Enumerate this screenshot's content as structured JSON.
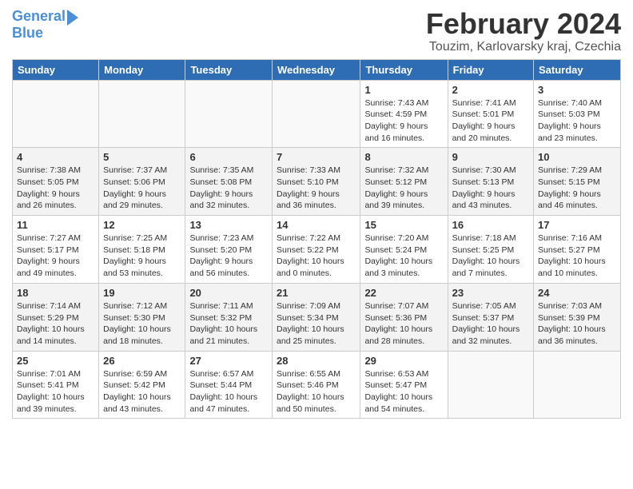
{
  "header": {
    "logo_line1": "General",
    "logo_line2": "Blue",
    "title": "February 2024",
    "subtitle": "Touzim, Karlovarsky kraj, Czechia"
  },
  "columns": [
    "Sunday",
    "Monday",
    "Tuesday",
    "Wednesday",
    "Thursday",
    "Friday",
    "Saturday"
  ],
  "weeks": [
    [
      {
        "num": "",
        "info": ""
      },
      {
        "num": "",
        "info": ""
      },
      {
        "num": "",
        "info": ""
      },
      {
        "num": "",
        "info": ""
      },
      {
        "num": "1",
        "info": "Sunrise: 7:43 AM\nSunset: 4:59 PM\nDaylight: 9 hours\nand 16 minutes."
      },
      {
        "num": "2",
        "info": "Sunrise: 7:41 AM\nSunset: 5:01 PM\nDaylight: 9 hours\nand 20 minutes."
      },
      {
        "num": "3",
        "info": "Sunrise: 7:40 AM\nSunset: 5:03 PM\nDaylight: 9 hours\nand 23 minutes."
      }
    ],
    [
      {
        "num": "4",
        "info": "Sunrise: 7:38 AM\nSunset: 5:05 PM\nDaylight: 9 hours\nand 26 minutes."
      },
      {
        "num": "5",
        "info": "Sunrise: 7:37 AM\nSunset: 5:06 PM\nDaylight: 9 hours\nand 29 minutes."
      },
      {
        "num": "6",
        "info": "Sunrise: 7:35 AM\nSunset: 5:08 PM\nDaylight: 9 hours\nand 32 minutes."
      },
      {
        "num": "7",
        "info": "Sunrise: 7:33 AM\nSunset: 5:10 PM\nDaylight: 9 hours\nand 36 minutes."
      },
      {
        "num": "8",
        "info": "Sunrise: 7:32 AM\nSunset: 5:12 PM\nDaylight: 9 hours\nand 39 minutes."
      },
      {
        "num": "9",
        "info": "Sunrise: 7:30 AM\nSunset: 5:13 PM\nDaylight: 9 hours\nand 43 minutes."
      },
      {
        "num": "10",
        "info": "Sunrise: 7:29 AM\nSunset: 5:15 PM\nDaylight: 9 hours\nand 46 minutes."
      }
    ],
    [
      {
        "num": "11",
        "info": "Sunrise: 7:27 AM\nSunset: 5:17 PM\nDaylight: 9 hours\nand 49 minutes."
      },
      {
        "num": "12",
        "info": "Sunrise: 7:25 AM\nSunset: 5:18 PM\nDaylight: 9 hours\nand 53 minutes."
      },
      {
        "num": "13",
        "info": "Sunrise: 7:23 AM\nSunset: 5:20 PM\nDaylight: 9 hours\nand 56 minutes."
      },
      {
        "num": "14",
        "info": "Sunrise: 7:22 AM\nSunset: 5:22 PM\nDaylight: 10 hours\nand 0 minutes."
      },
      {
        "num": "15",
        "info": "Sunrise: 7:20 AM\nSunset: 5:24 PM\nDaylight: 10 hours\nand 3 minutes."
      },
      {
        "num": "16",
        "info": "Sunrise: 7:18 AM\nSunset: 5:25 PM\nDaylight: 10 hours\nand 7 minutes."
      },
      {
        "num": "17",
        "info": "Sunrise: 7:16 AM\nSunset: 5:27 PM\nDaylight: 10 hours\nand 10 minutes."
      }
    ],
    [
      {
        "num": "18",
        "info": "Sunrise: 7:14 AM\nSunset: 5:29 PM\nDaylight: 10 hours\nand 14 minutes."
      },
      {
        "num": "19",
        "info": "Sunrise: 7:12 AM\nSunset: 5:30 PM\nDaylight: 10 hours\nand 18 minutes."
      },
      {
        "num": "20",
        "info": "Sunrise: 7:11 AM\nSunset: 5:32 PM\nDaylight: 10 hours\nand 21 minutes."
      },
      {
        "num": "21",
        "info": "Sunrise: 7:09 AM\nSunset: 5:34 PM\nDaylight: 10 hours\nand 25 minutes."
      },
      {
        "num": "22",
        "info": "Sunrise: 7:07 AM\nSunset: 5:36 PM\nDaylight: 10 hours\nand 28 minutes."
      },
      {
        "num": "23",
        "info": "Sunrise: 7:05 AM\nSunset: 5:37 PM\nDaylight: 10 hours\nand 32 minutes."
      },
      {
        "num": "24",
        "info": "Sunrise: 7:03 AM\nSunset: 5:39 PM\nDaylight: 10 hours\nand 36 minutes."
      }
    ],
    [
      {
        "num": "25",
        "info": "Sunrise: 7:01 AM\nSunset: 5:41 PM\nDaylight: 10 hours\nand 39 minutes."
      },
      {
        "num": "26",
        "info": "Sunrise: 6:59 AM\nSunset: 5:42 PM\nDaylight: 10 hours\nand 43 minutes."
      },
      {
        "num": "27",
        "info": "Sunrise: 6:57 AM\nSunset: 5:44 PM\nDaylight: 10 hours\nand 47 minutes."
      },
      {
        "num": "28",
        "info": "Sunrise: 6:55 AM\nSunset: 5:46 PM\nDaylight: 10 hours\nand 50 minutes."
      },
      {
        "num": "29",
        "info": "Sunrise: 6:53 AM\nSunset: 5:47 PM\nDaylight: 10 hours\nand 54 minutes."
      },
      {
        "num": "",
        "info": ""
      },
      {
        "num": "",
        "info": ""
      }
    ]
  ]
}
